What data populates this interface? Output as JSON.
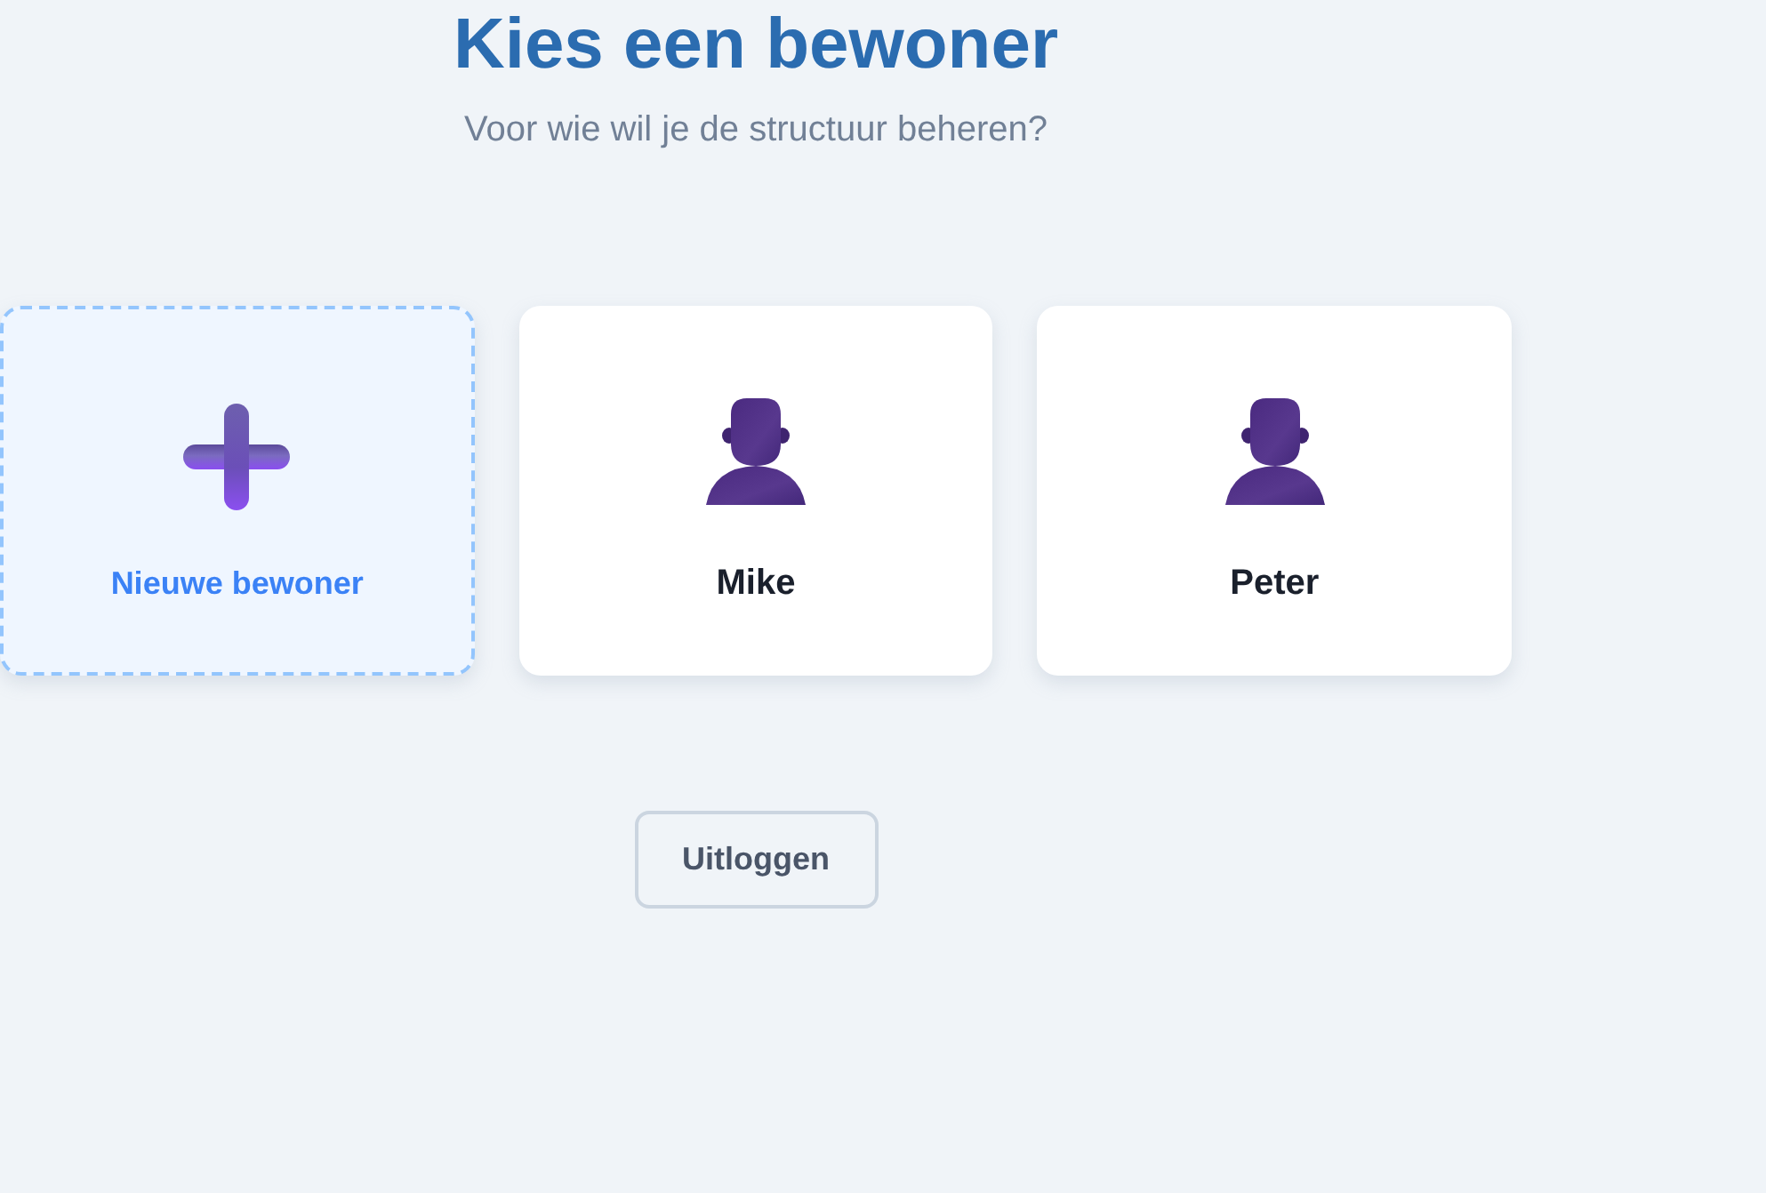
{
  "header": {
    "title": "Kies een bewoner",
    "subtitle": "Voor wie wil je de structuur beheren?"
  },
  "residents": [
    {
      "kind": "add",
      "name": "Nieuwe bewoner"
    },
    {
      "kind": "person",
      "name": "Mike"
    },
    {
      "kind": "person",
      "name": "Peter"
    }
  ],
  "buttons": [
    {
      "label": "Uitloggen"
    }
  ]
}
